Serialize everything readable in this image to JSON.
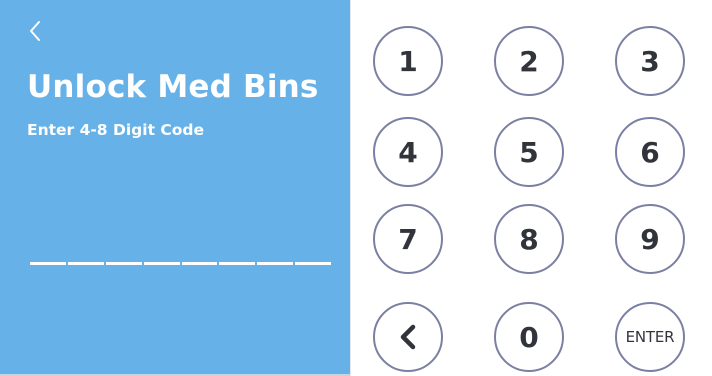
{
  "header": {
    "back_icon": "chevron-left-icon",
    "title": "Unlock Med Bins",
    "subtitle": "Enter 4-8 Digit Code"
  },
  "code_entry": {
    "slots": 8,
    "entered_digits": 0
  },
  "keypad": {
    "keys": [
      "1",
      "2",
      "3",
      "4",
      "5",
      "6",
      "7",
      "8",
      "9"
    ],
    "backspace_icon": "chevron-left-icon",
    "zero": "0",
    "enter": "ENTER"
  },
  "colors": {
    "panel_background": "#66b2e8",
    "text_on_panel": "#ffffff",
    "key_border": "#7b80a3",
    "key_text": "#32343c"
  }
}
